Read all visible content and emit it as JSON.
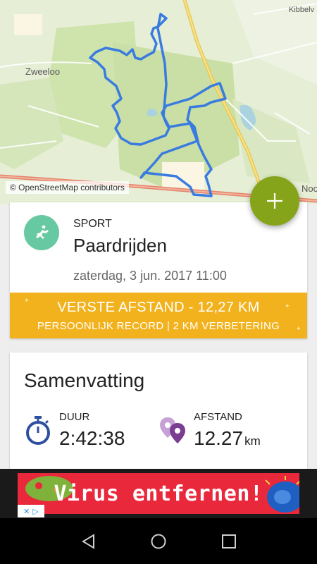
{
  "map": {
    "labels": {
      "zweeloo": "Zweeloo",
      "kibbelv": "Kibbelv",
      "noo": "Noo"
    },
    "attribution": "© OpenStreetMap contributors",
    "route_color": "#3a7be0"
  },
  "fab": {
    "label": "+",
    "icon": "plus-icon"
  },
  "activity": {
    "sport_label": "SPORT",
    "sport_name": "Paardrijden",
    "date": "zaterdag, 3 jun. 2017 11:00",
    "icon": "horse-riding-icon",
    "icon_bg": "#67c9a2"
  },
  "record": {
    "title": "VERSTE AFSTAND  -  12,27 KM",
    "subtitle": "PERSOONLIJK RECORD  |  2 KM VERBETERING",
    "color": "#f2b21d"
  },
  "summary": {
    "title": "Samenvatting",
    "duration_label": "DUUR",
    "duration_value": "2:42:38",
    "distance_label": "AFSTAND",
    "distance_value": "12.27",
    "distance_unit": "km"
  },
  "ad": {
    "text": "Virus entfernen!",
    "color": "#e9283c"
  },
  "navbar": {
    "back": "back-icon",
    "home": "home-icon",
    "recents": "recents-icon"
  }
}
